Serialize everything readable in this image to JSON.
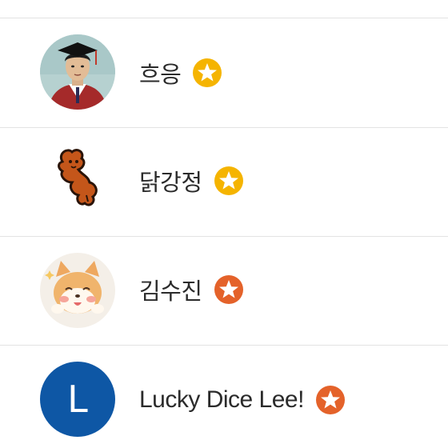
{
  "colors": {
    "gold_badge": "#f5b400",
    "bronze_badge": "#e4622a",
    "divider": "#e3e3e3",
    "letter_avatar": "#0e57a5"
  },
  "users": [
    {
      "name": "흐응",
      "badge": "star-icon",
      "badge_color": "#f5b400",
      "avatar": "student-photo-avatar"
    },
    {
      "name": "닭강정",
      "badge": "star-icon",
      "badge_color": "#f5b400",
      "avatar": "fried-chicken-avatar"
    },
    {
      "name": "김수진",
      "badge": "star-icon",
      "badge_color": "#e4622a",
      "avatar": "shiba-dog-avatar"
    },
    {
      "name": "Lucky Dice Lee!",
      "badge": "star-icon",
      "badge_color": "#e4622a",
      "avatar": "letter-avatar",
      "initial": "L"
    }
  ]
}
